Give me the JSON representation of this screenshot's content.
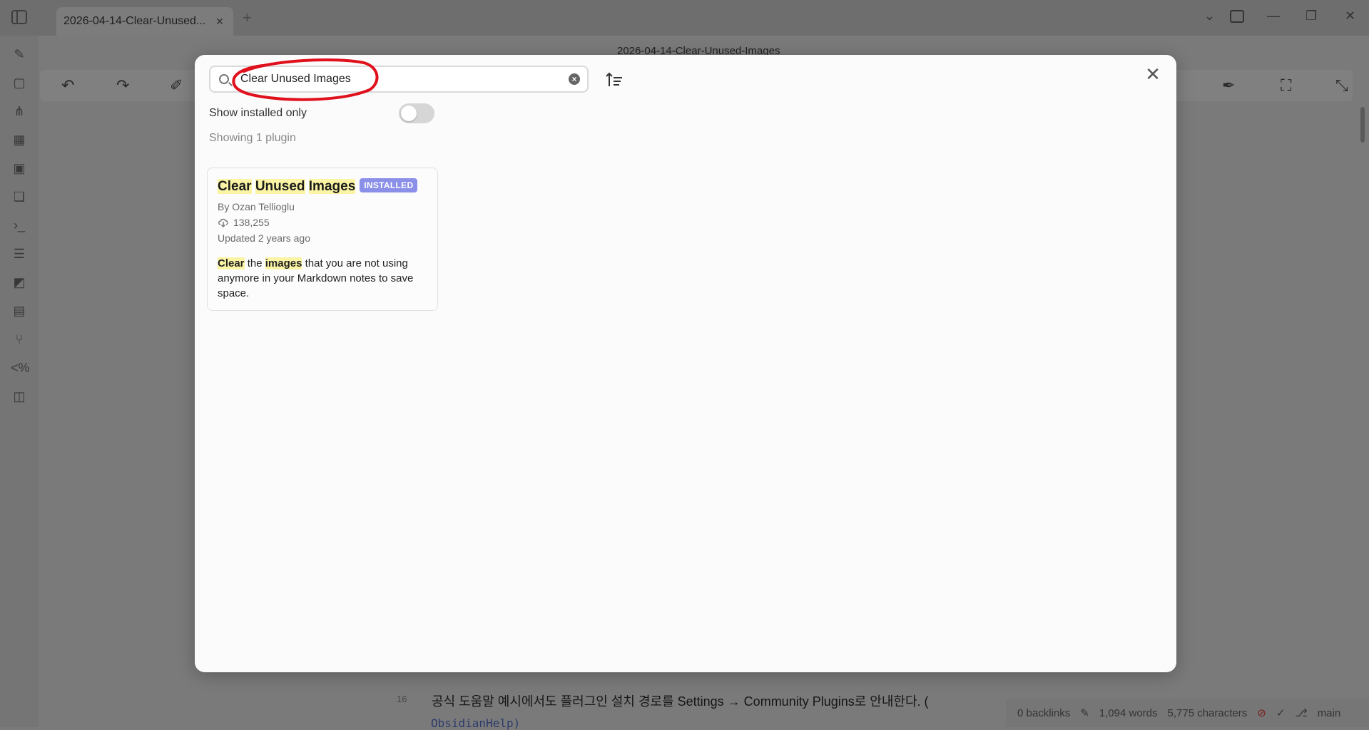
{
  "app": {
    "tab_title": "2026-04-14-Clear-Unused...",
    "note_title": "2026-04-14-Clear-Unused-Images",
    "editor_line_number": "16",
    "editor_line_text": "공식 도움말 예시에서도 플러그인 설치 경로를 Settings → Community Plugins로 안내한다. (",
    "editor_link_text": "ObsidianHelp)",
    "status": {
      "backlinks": "0 backlinks",
      "words": "1,094 words",
      "characters": "5,775 characters",
      "branch": "main"
    }
  },
  "modal": {
    "search": {
      "value": "Clear Unused Images",
      "placeholder": ""
    },
    "toggle_label": "Show installed only",
    "toggle_on": false,
    "result_count": "Showing 1 plugin",
    "plugins": [
      {
        "title_words": [
          "Clear",
          "Unused",
          "Images"
        ],
        "badge": "INSTALLED",
        "author": "By Ozan Tellioglu",
        "downloads": "138,255",
        "updated": "Updated 2 years ago",
        "desc_1": "Clear",
        "desc_2": " the ",
        "desc_3": "images",
        "desc_4": " that you are not using anymore in your Markdown notes to save space."
      }
    ]
  },
  "colors": {
    "highlight": "#fbf4a4",
    "badge": "#8a8fe8",
    "annotation_red": "#e0101c"
  }
}
